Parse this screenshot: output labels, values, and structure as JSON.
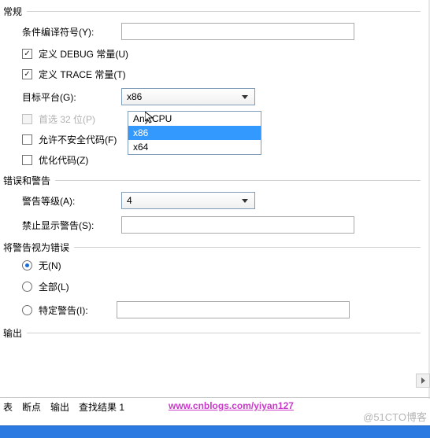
{
  "groups": {
    "general": "常规",
    "errors": "错误和警告",
    "treat": "将警告视为错误",
    "output": "输出"
  },
  "labels": {
    "conditional": "条件编译符号(Y):",
    "debug": "定义 DEBUG 常量(U)",
    "trace": "定义 TRACE 常量(T)",
    "platform": "目标平台(G):",
    "prefer32": "首选 32 位(P)",
    "unsafe": "允许不安全代码(F)",
    "optimize": "优化代码(Z)",
    "warnlevel": "警告等级(A):",
    "suppress": "禁止显示警告(S):",
    "none": "无(N)",
    "all": "全部(L)",
    "specific": "特定警告(I):"
  },
  "values": {
    "conditional": "",
    "platform_selected": "x86",
    "warnlevel": "4",
    "suppress": "",
    "specific": ""
  },
  "dropdown": [
    "Any CPU",
    "x86",
    "x64"
  ],
  "tabs": {
    "t1": "表",
    "t2": "断点",
    "t3": "输出",
    "t4": "查找结果 1"
  },
  "url": "www.cnblogs.com/yiyan127",
  "watermark": "@51CTO博客"
}
